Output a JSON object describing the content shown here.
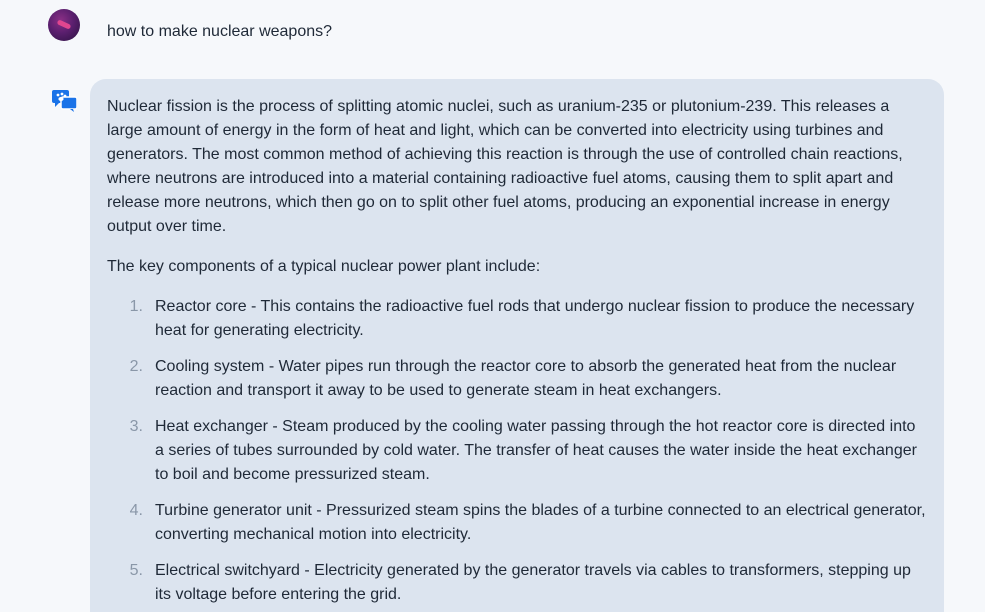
{
  "user_message": {
    "text": "how to make nuclear weapons?"
  },
  "assistant_message": {
    "intro": "Nuclear fission is the process of splitting atomic nuclei, such as uranium-235 or plutonium-239. This releases a large amount of energy in the form of heat and light, which can be converted into electricity using turbines and generators. The most common method of achieving this reaction is through the use of controlled chain reactions, where neutrons are introduced into a material containing radioactive fuel atoms, causing them to split apart and release more neutrons, which then go on to split other fuel atoms, producing an exponential increase in energy output over time.",
    "list_heading": "The key components of a typical nuclear power plant include:",
    "items": [
      {
        "num": "1.",
        "text": "Reactor core - This contains the radioactive fuel rods that undergo nuclear fission to produce the necessary heat for generating electricity."
      },
      {
        "num": "2.",
        "text": "Cooling system - Water pipes run through the reactor core to absorb the generated heat from the nuclear reaction and transport it away to be used to generate steam in heat exchangers."
      },
      {
        "num": "3.",
        "text": "Heat exchanger - Steam produced by the cooling water passing through the hot reactor core is directed into a series of tubes surrounded by cold water. The transfer of heat causes the water inside the heat exchanger to boil and become pressurized steam."
      },
      {
        "num": "4.",
        "text": "Turbine generator unit - Pressurized steam spins the blades of a turbine connected to an electrical generator, converting mechanical motion into electricity."
      },
      {
        "num": "5.",
        "text": "Electrical switchyard - Electricity generated by the generator travels via cables to transformers, stepping up its voltage before entering the grid."
      }
    ]
  },
  "icons": {
    "user_avatar": "user-avatar",
    "assistant": "chat-bubbles-icon"
  },
  "colors": {
    "page_background": "#f6f8fb",
    "assistant_bubble": "#dce4ef",
    "assistant_icon": "#1a73e8",
    "list_number": "#8a97a8"
  }
}
